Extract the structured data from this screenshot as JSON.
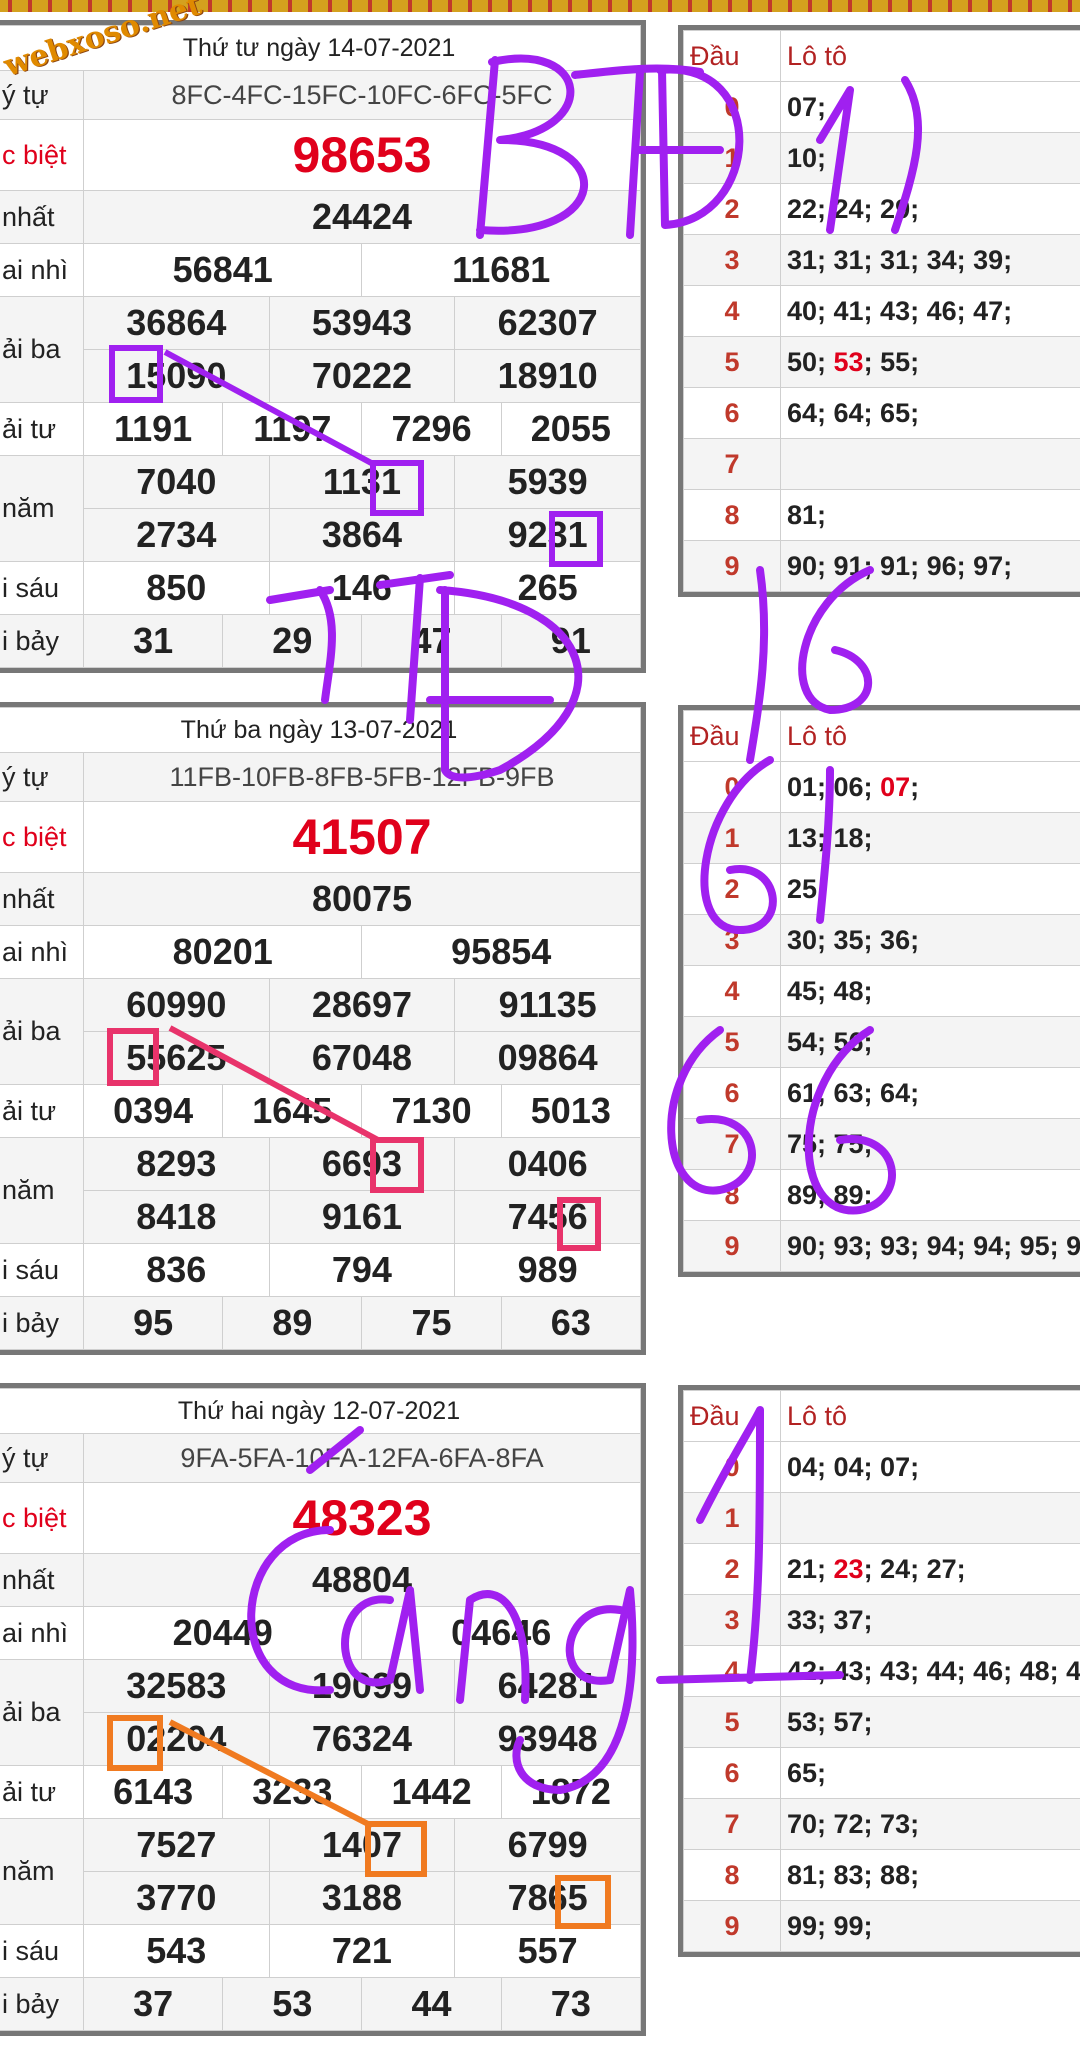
{
  "logo_text": "webxoso.net",
  "blocks": [
    {
      "date": "Thứ tư ngày 14-07-2021",
      "label_code": "ý tự",
      "code": "8FC-4FC-15FC-10FC-6FC-5FC",
      "label_db": "c biệt",
      "db": "98653",
      "label_g1": "nhất",
      "g1": "24424",
      "label_g2": "ai nhì",
      "g2": [
        "56841",
        "11681"
      ],
      "label_g3": "ải ba",
      "g3": [
        "36864",
        "53943",
        "62307",
        "15090",
        "70222",
        "18910"
      ],
      "label_g4": "ải tư",
      "g4": [
        "1191",
        "1197",
        "7296",
        "2055"
      ],
      "label_g5": "năm",
      "g5": [
        "7040",
        "1131",
        "5939",
        "2734",
        "3864",
        "9231"
      ],
      "label_g6": "i sáu",
      "g6": [
        "850",
        "146",
        "265"
      ],
      "label_g7": "i bảy",
      "g7": [
        "31",
        "29",
        "47",
        "91"
      ],
      "loto_head_label": "Đầu",
      "loto_label": "Lô tô",
      "loto": [
        {
          "head": "0",
          "values": "07;"
        },
        {
          "head": "1",
          "values": "10;"
        },
        {
          "head": "2",
          "values": "22; 24; 29;"
        },
        {
          "head": "3",
          "values": "31; 31; 31; 34; 39;"
        },
        {
          "head": "4",
          "values": "40; 41; 43; 46; 47;"
        },
        {
          "head": "5",
          "values_pre": "50; ",
          "values_hl": "53",
          "values_post": "; 55;"
        },
        {
          "head": "6",
          "values": "64; 64; 65;"
        },
        {
          "head": "7",
          "values": ""
        },
        {
          "head": "8",
          "values": "81;"
        },
        {
          "head": "9",
          "values": "90; 91; 91; 96; 97;"
        }
      ]
    },
    {
      "date": "Thứ ba ngày 13-07-2021",
      "label_code": "ý tự",
      "code": "11FB-10FB-8FB-5FB-12FB-9FB",
      "label_db": "c biệt",
      "db": "41507",
      "label_g1": "nhất",
      "g1": "80075",
      "label_g2": "ai nhì",
      "g2": [
        "80201",
        "95854"
      ],
      "label_g3": "ải ba",
      "g3": [
        "60990",
        "28697",
        "91135",
        "55625",
        "67048",
        "09864"
      ],
      "label_g4": "ải tư",
      "g4": [
        "0394",
        "1645",
        "7130",
        "5013"
      ],
      "label_g5": "năm",
      "g5": [
        "8293",
        "6693",
        "0406",
        "8418",
        "9161",
        "7456"
      ],
      "label_g6": "i sáu",
      "g6": [
        "836",
        "794",
        "989"
      ],
      "label_g7": "i bảy",
      "g7": [
        "95",
        "89",
        "75",
        "63"
      ],
      "loto_head_label": "Đầu",
      "loto_label": "Lô tô",
      "loto": [
        {
          "head": "0",
          "values_pre": "01; 06; ",
          "values_hl": "07",
          "values_post": ";"
        },
        {
          "head": "1",
          "values": "13; 18;"
        },
        {
          "head": "2",
          "values": "25;"
        },
        {
          "head": "3",
          "values": "30; 35; 36;"
        },
        {
          "head": "4",
          "values": "45; 48;"
        },
        {
          "head": "5",
          "values": "54; 56;"
        },
        {
          "head": "6",
          "values": "61; 63; 64;"
        },
        {
          "head": "7",
          "values": "75; 75;"
        },
        {
          "head": "8",
          "values": "89; 89;"
        },
        {
          "head": "9",
          "values": "90; 93; 93; 94; 94; 95; 9"
        }
      ]
    },
    {
      "date": "Thứ hai ngày 12-07-2021",
      "label_code": "ý tự",
      "code": "9FA-5FA-10FA-12FA-6FA-8FA",
      "label_db": "c biệt",
      "db": "48323",
      "label_g1": "nhất",
      "g1": "48804",
      "label_g2": "ai nhì",
      "g2": [
        "20449",
        "04646"
      ],
      "label_g3": "ải ba",
      "g3": [
        "32583",
        "19099",
        "64281",
        "02204",
        "76324",
        "93948"
      ],
      "label_g4": "ải tư",
      "g4": [
        "6143",
        "3233",
        "1442",
        "1872"
      ],
      "label_g5": "năm",
      "g5": [
        "7527",
        "1407",
        "6799",
        "3770",
        "3188",
        "7865"
      ],
      "label_g6": "i sáu",
      "g6": [
        "543",
        "721",
        "557"
      ],
      "label_g7": "i bảy",
      "g7": [
        "37",
        "53",
        "44",
        "73"
      ],
      "loto_head_label": "Đầu",
      "loto_label": "Lô tô",
      "loto": [
        {
          "head": "0",
          "values": "04; 04; 07;"
        },
        {
          "head": "1",
          "values": ""
        },
        {
          "head": "2",
          "values_pre": "21; ",
          "values_hl": "23",
          "values_post": "; 24; 27;"
        },
        {
          "head": "3",
          "values": "33; 37;"
        },
        {
          "head": "4",
          "values": "42; 43; 43; 44; 46; 48; 4"
        },
        {
          "head": "5",
          "values": "53; 57;"
        },
        {
          "head": "6",
          "values": "65;"
        },
        {
          "head": "7",
          "values": "70; 72; 73;"
        },
        {
          "head": "8",
          "values": "81; 83; 88;"
        },
        {
          "head": "9",
          "values": "99; 99;"
        }
      ]
    }
  ],
  "annotations": {
    "handwriting": [
      "BTĐ 11",
      "16 TTĐ 61 66",
      "Càng 1"
    ],
    "colors": {
      "purple": "#a020f0",
      "pink": "#e8336b",
      "orange": "#f07a20",
      "red": "#e0001b"
    }
  }
}
